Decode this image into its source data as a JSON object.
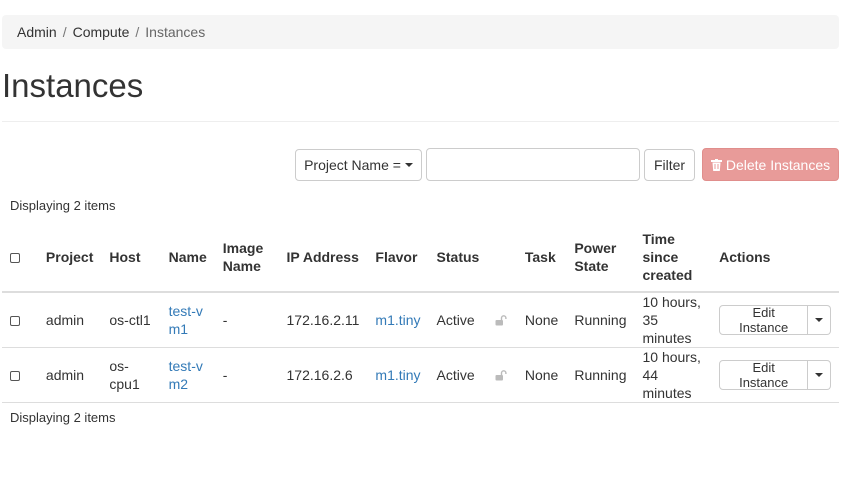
{
  "breadcrumb": {
    "items": [
      "Admin",
      "Compute"
    ],
    "active": "Instances"
  },
  "page_title": "Instances",
  "filter": {
    "project_label": "Project Name =",
    "input_value": "",
    "filter_label": "Filter",
    "delete_label": "Delete Instances"
  },
  "count_text": "Displaying 2 items",
  "table": {
    "headers": {
      "project": "Project",
      "host": "Host",
      "name": "Name",
      "image_name_1": "Image",
      "image_name_2": "Name",
      "ip": "IP Address",
      "flavor": "Flavor",
      "status": "Status",
      "task": "Task",
      "power_1": "Power",
      "power_2": "State",
      "time_1": "Time",
      "time_2": "since",
      "time_3": "created",
      "actions": "Actions"
    },
    "rows": [
      {
        "project": "admin",
        "host": "os-ctl1",
        "name_1": "test-v",
        "name_2": "m1",
        "image_name": "-",
        "ip": "172.16.2.11",
        "flavor": "m1.tiny",
        "status": "Active",
        "task": "None",
        "power": "Running",
        "time_1": "10 hours,",
        "time_2": "35 minutes",
        "action_label": "Edit Instance"
      },
      {
        "project": "admin",
        "host": "os-cpu1",
        "name_1": "test-v",
        "name_2": "m2",
        "image_name": "-",
        "ip": "172.16.2.6",
        "flavor": "m1.tiny",
        "status": "Active",
        "task": "None",
        "power": "Running",
        "time_1": "10 hours,",
        "time_2": "44 minutes",
        "action_label": "Edit Instance"
      }
    ]
  },
  "icons": {
    "delete": "trash-icon",
    "lock": "unlock-icon",
    "caret": "caret-down-icon"
  },
  "colors": {
    "link": "#337ab7",
    "danger": "#e89b99"
  }
}
